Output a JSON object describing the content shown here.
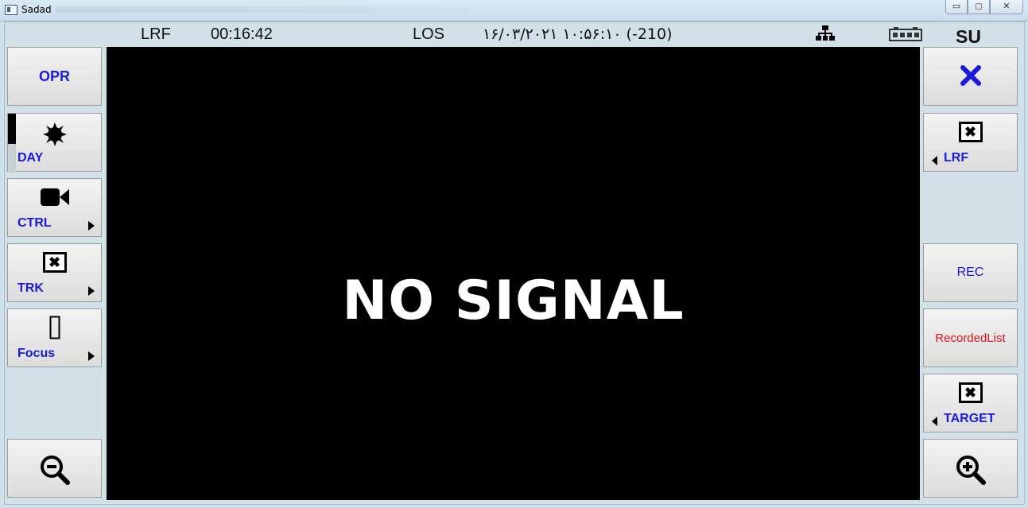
{
  "window": {
    "title": "Sadad",
    "min": "▭",
    "max": "◻",
    "close": "✕"
  },
  "status": {
    "mode": "LRF",
    "elapsed": "00:16:42",
    "los": "LOS",
    "datetime": "۱۶/۰۳/۲۰۲۱ ۱۰:۵۶:۱۰ (-210)",
    "unit": "SU"
  },
  "video": {
    "message": "NO SIGNAL"
  },
  "left": {
    "opr": "OPR",
    "day": "DAY",
    "ctrl": "CTRL",
    "trk": "TRK",
    "focus": "Focus"
  },
  "right": {
    "lrf": "LRF",
    "rec": "REC",
    "recorded_list": "RecordedList",
    "target": "TARGET"
  },
  "icons": {
    "app": "app-icon",
    "network": "network-icon",
    "battery": "battery-icon",
    "close": "close-icon",
    "sun": "sun-icon",
    "camera": "video-camera-icon",
    "track": "box-x-icon",
    "focus": "focus-rectangle-icon",
    "zoom_out": "zoom-out-icon",
    "zoom_in": "zoom-in-icon"
  },
  "colors": {
    "label": "#1a1adb",
    "recorded_list": "#e0101a",
    "video_bg": "#000000"
  }
}
